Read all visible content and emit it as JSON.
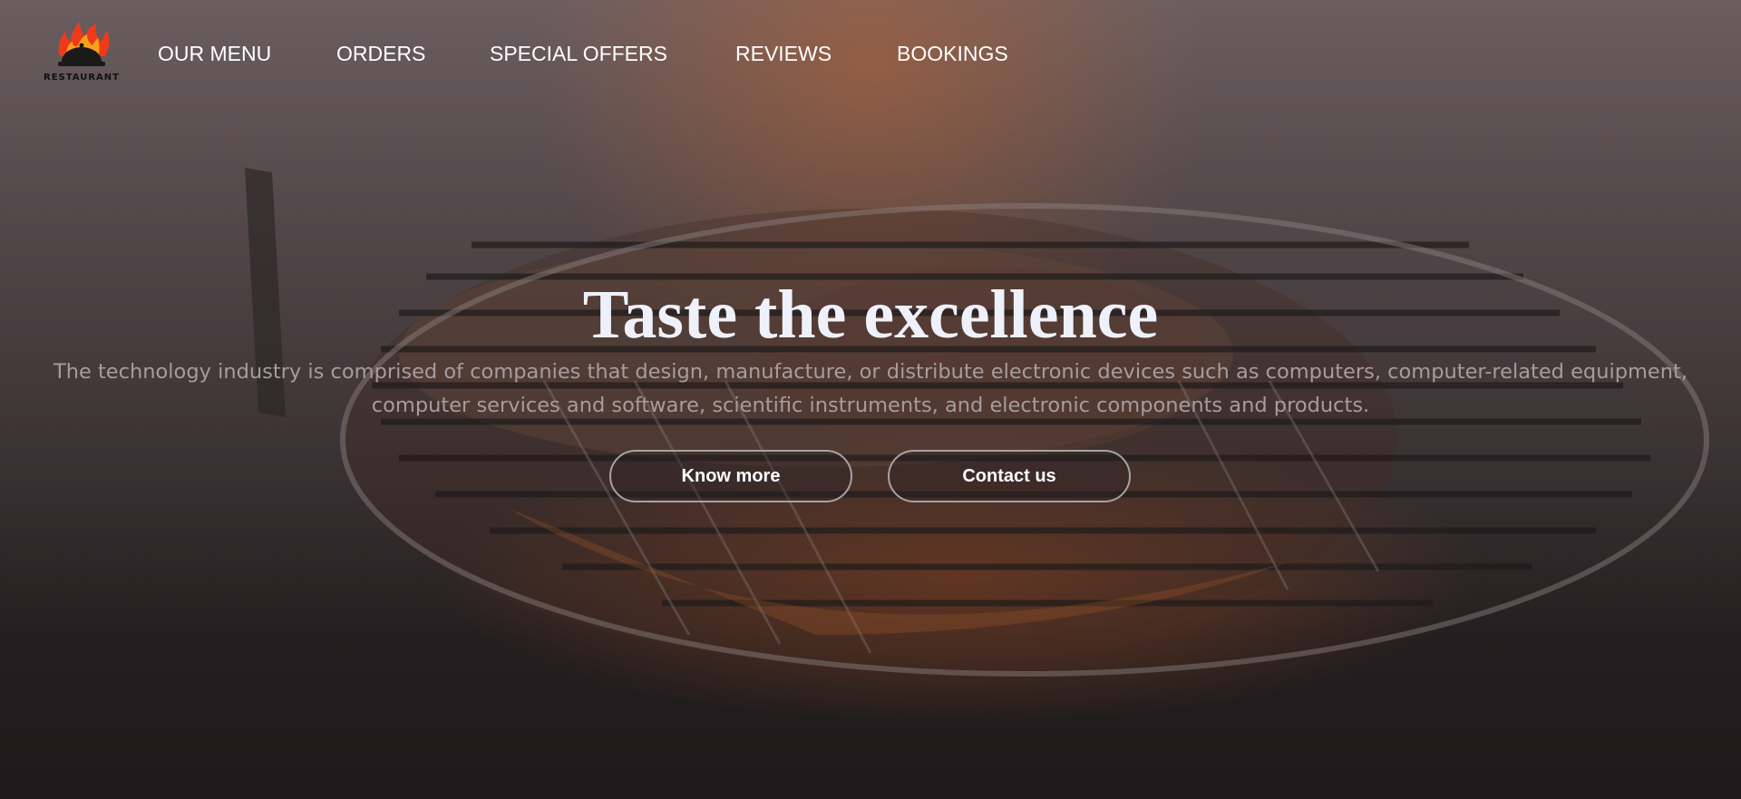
{
  "brand": {
    "logo_text": "RESTAURANT",
    "accent": "#e8391c"
  },
  "nav": {
    "items": [
      {
        "label": "OUR MENU"
      },
      {
        "label": "ORDERS"
      },
      {
        "label": "SPECIAL OFFERS"
      },
      {
        "label": "REVIEWS"
      },
      {
        "label": "BOOKINGS"
      }
    ]
  },
  "hero": {
    "title": "Taste the excellence",
    "description": "The technology industry is comprised of companies that design, manufacture, or distribute electronic devices such as computers, computer-related equipment, computer services and software, scientific instruments, and electronic components and products.",
    "buttons": {
      "know_more": "Know more",
      "contact": "Contact us"
    }
  }
}
